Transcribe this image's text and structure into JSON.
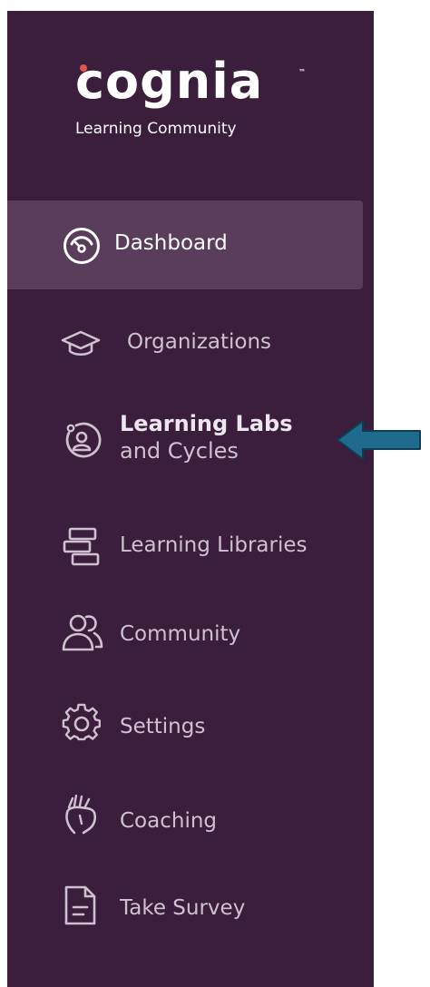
{
  "brand": {
    "logo_text": "cognia",
    "trademark": "™",
    "tagline": "Learning Community"
  },
  "nav": {
    "items": [
      {
        "label": "Dashboard",
        "icon": "gauge-icon",
        "active": true
      },
      {
        "label": "Organizations",
        "icon": "graduation-cap-icon"
      },
      {
        "label": "Learning Labs",
        "sublabel": "and Cycles",
        "icon": "learning-cycle-icon"
      },
      {
        "label": "Learning Libraries",
        "icon": "library-stack-icon"
      },
      {
        "label": "Community",
        "icon": "community-people-icon"
      },
      {
        "label": "Settings",
        "icon": "gear-icon"
      },
      {
        "label": "Coaching",
        "icon": "coaching-hands-icon"
      },
      {
        "label": "Take Survey",
        "icon": "document-icon"
      }
    ]
  },
  "annotation": {
    "icon": "arrow-left-icon",
    "color": "#1f6b8e"
  },
  "colors": {
    "sidebar_bg": "#3b1d3c",
    "active_bg": "#5a3d5b",
    "logo_dot": "#e2524f",
    "text": "#cfc2cf"
  }
}
